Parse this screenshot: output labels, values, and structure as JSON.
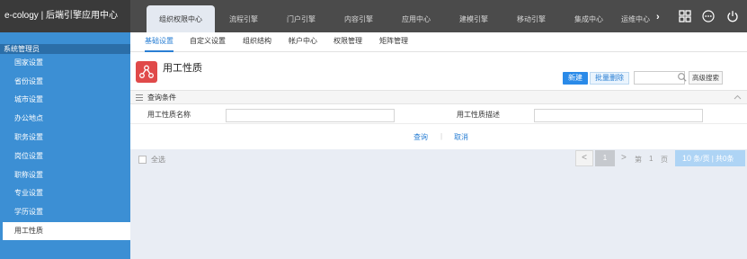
{
  "app": {
    "title": "e-cology | 后端引擎应用中心"
  },
  "top_nav": {
    "tabs": [
      {
        "label": "组织权限中心",
        "active": true
      },
      {
        "label": "流程引擎",
        "active": false
      },
      {
        "label": "门户引擎",
        "active": false
      },
      {
        "label": "内容引擎",
        "active": false
      },
      {
        "label": "应用中心",
        "active": false
      },
      {
        "label": "建模引擎",
        "active": false
      },
      {
        "label": "移动引擎",
        "active": false
      },
      {
        "label": "集成中心",
        "active": false
      },
      {
        "label": "运维中心",
        "active": false
      }
    ],
    "more_arrow": "›",
    "icons": [
      "grid-icon",
      "more-icon",
      "power-icon"
    ]
  },
  "sidebar": {
    "header": "系统管理员",
    "items": [
      {
        "label": "国家设置",
        "active": false
      },
      {
        "label": "省份设置",
        "active": false
      },
      {
        "label": "城市设置",
        "active": false
      },
      {
        "label": "办公地点",
        "active": false
      },
      {
        "label": "职务设置",
        "active": false
      },
      {
        "label": "岗位设置",
        "active": false
      },
      {
        "label": "职称设置",
        "active": false
      },
      {
        "label": "专业设置",
        "active": false
      },
      {
        "label": "学历设置",
        "active": false
      },
      {
        "label": "用工性质",
        "active": true
      }
    ]
  },
  "sub_nav": {
    "tabs": [
      {
        "label": "基础设置",
        "active": true
      },
      {
        "label": "自定义设置",
        "active": false
      },
      {
        "label": "组织结构",
        "active": false
      },
      {
        "label": "帐户中心",
        "active": false
      },
      {
        "label": "权限管理",
        "active": false
      },
      {
        "label": "矩阵管理",
        "active": false
      }
    ]
  },
  "main": {
    "title": "用工性质",
    "buttons": {
      "new": "新建",
      "batch_delete": "批量删除",
      "advanced_search": "高级搜索"
    },
    "search": {
      "value": "",
      "placeholder": ""
    },
    "query": {
      "label": "查询条件",
      "fields": [
        {
          "label": "用工性质名称",
          "value": ""
        },
        {
          "label": "用工性质描述",
          "value": ""
        }
      ],
      "search_link": "查询",
      "separator": "|",
      "cancel_link": "取消"
    }
  },
  "footer": {
    "select_all": "全选",
    "pager": {
      "prev": "<",
      "current_page": "1",
      "next": ">",
      "goto_prefix": "第",
      "goto_value": "1",
      "goto_suffix": "页",
      "page_size": "10",
      "summary": "条/页 | 共0条"
    }
  },
  "colors": {
    "topbar": "#4b4b4b",
    "sidebar": "#3c8fd4",
    "accent": "#2a7fd4",
    "page_icon": "#e04a4a"
  }
}
